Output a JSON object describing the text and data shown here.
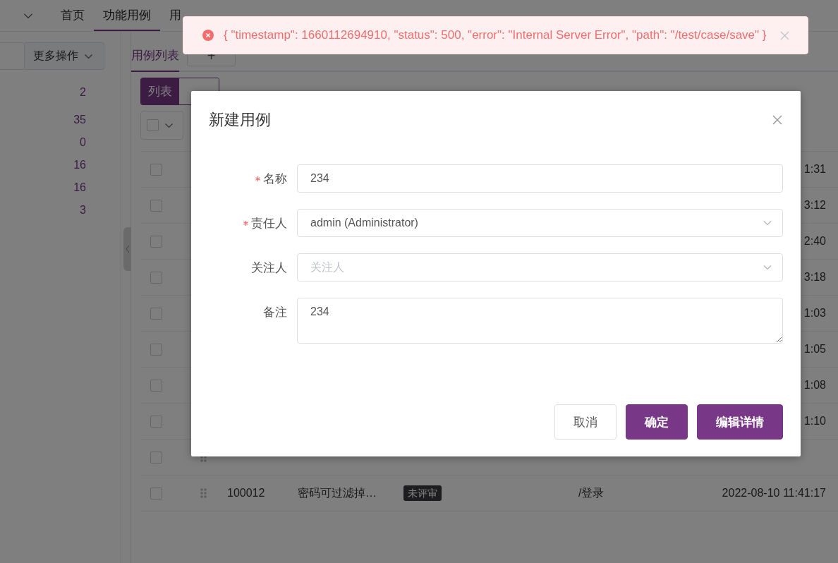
{
  "nav": {
    "tabs": [
      {
        "label": "首页",
        "selected": false
      },
      {
        "label": "功能用例",
        "selected": true
      },
      {
        "label": "用",
        "selected": false
      }
    ]
  },
  "sidebar": {
    "more_button": "更多操作",
    "counts": [
      "2",
      "35",
      "0",
      "16",
      "16",
      "3"
    ]
  },
  "main": {
    "tabs": [
      {
        "label": "用例列表",
        "selected": true
      }
    ],
    "add_button": "+",
    "view_toggle": [
      {
        "label": "列表",
        "selected": true
      },
      {
        "selected": false
      }
    ],
    "select_all": {
      "checked": false
    },
    "rows": [
      {
        "kind": "covered",
        "checked": false,
        "time": "1:31"
      },
      {
        "kind": "covered",
        "checked": false,
        "time": "3:12"
      },
      {
        "kind": "covered",
        "checked": false,
        "time": "2:40"
      },
      {
        "kind": "covered",
        "checked": false,
        "time": "3:18"
      },
      {
        "kind": "covered",
        "checked": false,
        "time": "1:03"
      },
      {
        "kind": "covered",
        "checked": false,
        "time": "1:05"
      },
      {
        "kind": "covered",
        "checked": false,
        "time": "1:08"
      },
      {
        "kind": "covered",
        "checked": false,
        "time": "1:10"
      },
      {
        "kind": "handle",
        "checked": false
      },
      {
        "kind": "full",
        "checked": false,
        "id": "100012",
        "name": "密码可过滤掉…",
        "status": "未评审",
        "module": "/登录",
        "time": "2022-08-10 11:41:17"
      }
    ]
  },
  "dialog": {
    "title": "新建用例",
    "fields": [
      {
        "kind": "input",
        "label": "名称",
        "required": true,
        "value": "234"
      },
      {
        "kind": "select",
        "label": "责任人",
        "required": true,
        "value": "admin (Administrator)"
      },
      {
        "kind": "select",
        "label": "关注人",
        "required": false,
        "placeholder": "关注人"
      },
      {
        "kind": "textarea",
        "label": "备注",
        "required": false,
        "value": "234"
      }
    ],
    "buttons": [
      {
        "label": "取消",
        "kind": "default"
      },
      {
        "label": "确定",
        "kind": "primary"
      },
      {
        "label": "编辑详情",
        "kind": "primary"
      }
    ]
  },
  "toast": {
    "message": "{ \"timestamp\": 1660112694910, \"status\": 500, \"error\": \"Internal Server Error\", \"path\": \"/test/case/save\" }"
  }
}
